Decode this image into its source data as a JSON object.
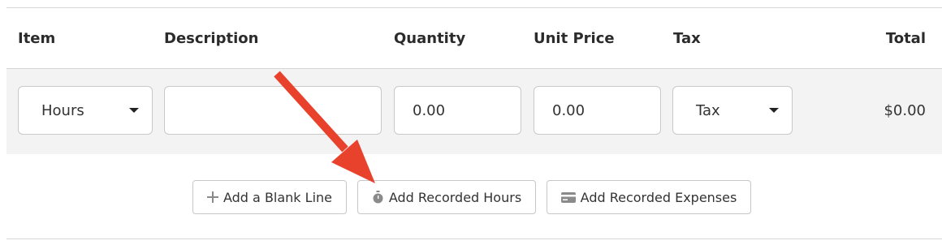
{
  "table": {
    "headers": {
      "item": "Item",
      "description": "Description",
      "quantity": "Quantity",
      "unit_price": "Unit Price",
      "tax": "Tax",
      "total": "Total"
    },
    "row": {
      "item_value": "Hours",
      "description_value": "",
      "quantity_value": "0.00",
      "unit_price_value": "0.00",
      "tax_value": "Tax",
      "total_value": "$0.00"
    }
  },
  "actions": {
    "add_blank_line": {
      "label": "Add a Blank Line",
      "icon": "plus-icon"
    },
    "add_recorded_hours": {
      "label": "Add Recorded Hours",
      "icon": "stopwatch-icon"
    },
    "add_recorded_expenses": {
      "label": "Add Recorded Expenses",
      "icon": "credit-card-icon"
    }
  },
  "annotation": {
    "arrow_color": "#e8412c",
    "icon": "arrow-icon"
  }
}
